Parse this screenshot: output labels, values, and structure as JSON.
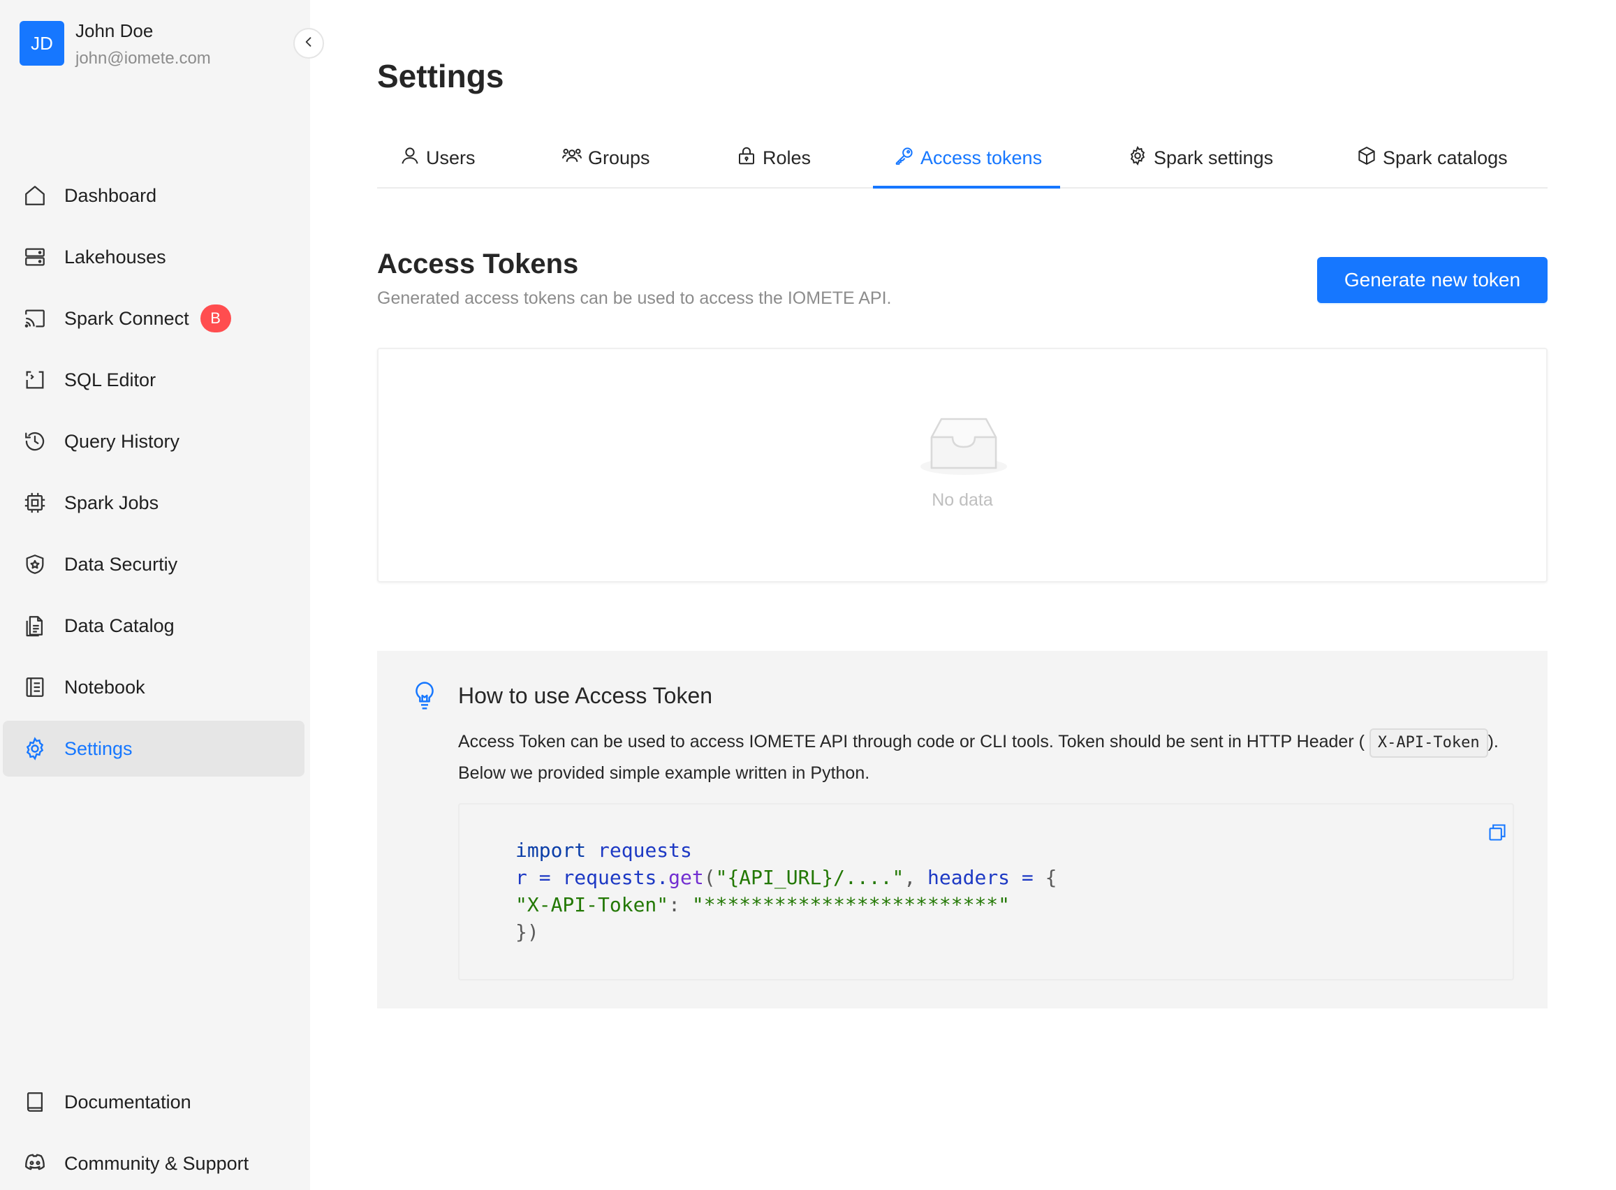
{
  "user": {
    "initials": "JD",
    "name": "John Doe",
    "email": "john@iomete.com"
  },
  "sidebar": {
    "items": [
      {
        "label": "Dashboard",
        "icon": "home-icon"
      },
      {
        "label": "Lakehouses",
        "icon": "server-icon"
      },
      {
        "label": "Spark Connect",
        "icon": "cast-icon",
        "badge": "B"
      },
      {
        "label": "SQL Editor",
        "icon": "code-editor-icon"
      },
      {
        "label": "Query History",
        "icon": "history-icon"
      },
      {
        "label": "Spark Jobs",
        "icon": "chip-icon"
      },
      {
        "label": "Data Securtiy",
        "icon": "shield-icon"
      },
      {
        "label": "Data Catalog",
        "icon": "document-icon"
      },
      {
        "label": "Notebook",
        "icon": "notebook-icon"
      },
      {
        "label": "Settings",
        "icon": "gear-icon",
        "active": true
      }
    ],
    "bottom_items": [
      {
        "label": "Documentation",
        "icon": "book-icon"
      },
      {
        "label": "Community & Support",
        "icon": "discord-icon"
      }
    ]
  },
  "page": {
    "title": "Settings"
  },
  "tabs": [
    {
      "label": "Users",
      "icon": "user-icon"
    },
    {
      "label": "Groups",
      "icon": "team-icon"
    },
    {
      "label": "Roles",
      "icon": "lock-icon"
    },
    {
      "label": "Access tokens",
      "icon": "key-icon",
      "active": true
    },
    {
      "label": "Spark settings",
      "icon": "gear-icon"
    },
    {
      "label": "Spark catalogs",
      "icon": "cube-icon"
    }
  ],
  "access_tokens": {
    "title": "Access Tokens",
    "subtitle": "Generated access tokens can be used to access the IOMETE API.",
    "generate_button": "Generate new token",
    "empty_text": "No data"
  },
  "howto": {
    "title": "How to use Access Token",
    "body_part1": "Access Token can be used to access IOMETE API through code or CLI tools. Token should be sent in HTTP Header (",
    "header_code": "X-API-Token",
    "body_part2": ").",
    "body_line2": "Below we provided simple example written in Python.",
    "code": {
      "l1_kw": "import",
      "l1_mod": "requests",
      "l2_var": "r",
      "l2_eq": "=",
      "l2_obj": "requests",
      "l2_dot": ".",
      "l2_fn": "get",
      "l2_open": "(",
      "l2_str": "\"{API_URL}/....\"",
      "l2_comma": ",",
      "l2_kwarg": "headers",
      "l2_eq2": "=",
      "l2_brace": "{",
      "l3_key": "\"X-API-Token\"",
      "l3_colon": ":",
      "l3_val": "\"*************************\"",
      "l4": "})"
    }
  },
  "colors": {
    "accent": "#1677ff",
    "badge": "#ff4d4f",
    "sidebar_bg": "#f5f5f5"
  }
}
